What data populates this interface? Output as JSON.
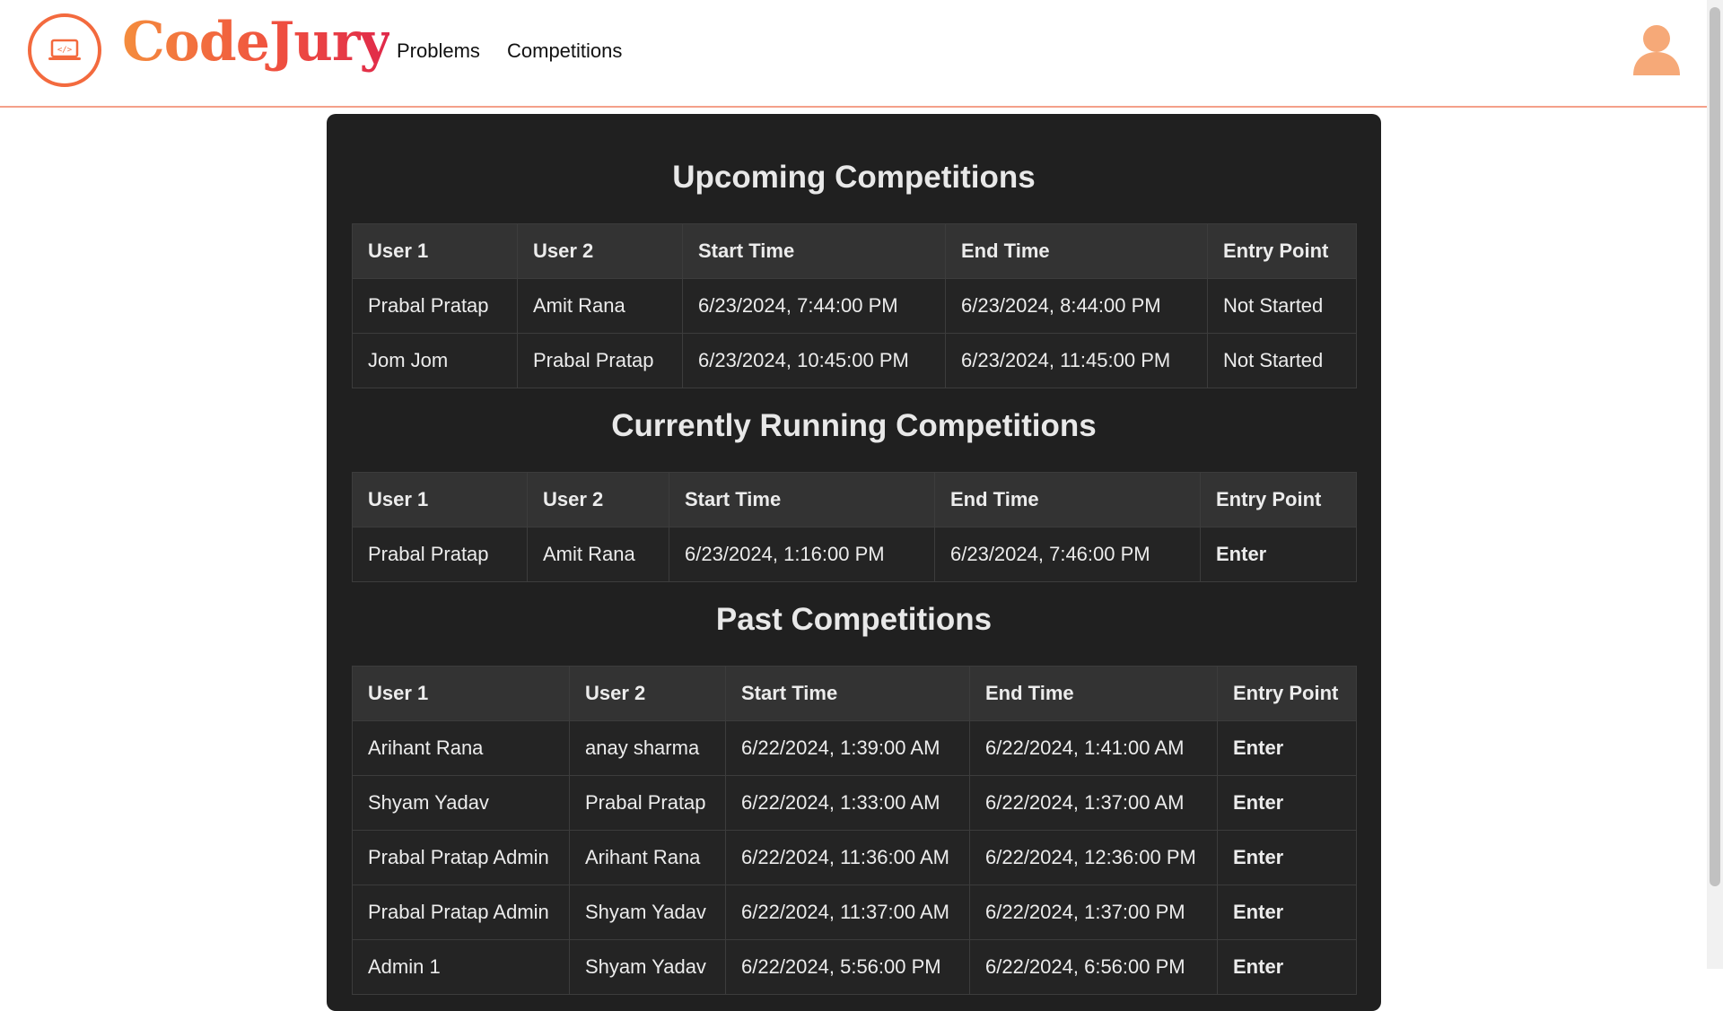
{
  "brand": "CodeJury",
  "nav": {
    "problems": "Problems",
    "competitions": "Competitions"
  },
  "colors": {
    "accent": "#f36a3e",
    "time": "#2ef01e",
    "link": "#1eb4f0",
    "panel": "#202020"
  },
  "upcoming": {
    "title": "Upcoming Competitions",
    "headers": [
      "User 1",
      "User 2",
      "Start Time",
      "End Time",
      "Entry Point"
    ],
    "rows": [
      {
        "user1": "Prabal Pratap",
        "user2": "Amit Rana",
        "start": "6/23/2024, 7:44:00 PM",
        "end": "6/23/2024, 8:44:00 PM",
        "entry": "Not Started"
      },
      {
        "user1": "Jom Jom",
        "user2": "Prabal Pratap",
        "start": "6/23/2024, 10:45:00 PM",
        "end": "6/23/2024, 11:45:00 PM",
        "entry": "Not Started"
      }
    ]
  },
  "running": {
    "title": "Currently Running Competitions",
    "headers": [
      "User 1",
      "User 2",
      "Start Time",
      "End Time",
      "Entry Point"
    ],
    "rows": [
      {
        "user1": "Prabal Pratap",
        "user2": "Amit Rana",
        "start": "6/23/2024, 1:16:00 PM",
        "end": "6/23/2024, 7:46:00 PM",
        "entry": "Enter"
      }
    ]
  },
  "past": {
    "title": "Past Competitions",
    "headers": [
      "User 1",
      "User 2",
      "Start Time",
      "End Time",
      "Entry Point"
    ],
    "rows": [
      {
        "user1": "Arihant Rana",
        "user2": "anay sharma",
        "start": "6/22/2024, 1:39:00 AM",
        "end": "6/22/2024, 1:41:00 AM",
        "entry": "Enter"
      },
      {
        "user1": "Shyam Yadav",
        "user2": "Prabal Pratap",
        "start": "6/22/2024, 1:33:00 AM",
        "end": "6/22/2024, 1:37:00 AM",
        "entry": "Enter"
      },
      {
        "user1": "Prabal Pratap Admin",
        "user2": "Arihant Rana",
        "start": "6/22/2024, 11:36:00 AM",
        "end": "6/22/2024, 12:36:00 PM",
        "entry": "Enter"
      },
      {
        "user1": "Prabal Pratap Admin",
        "user2": "Shyam Yadav",
        "start": "6/22/2024, 11:37:00 AM",
        "end": "6/22/2024, 1:37:00 PM",
        "entry": "Enter"
      },
      {
        "user1": "Admin 1",
        "user2": "Shyam Yadav",
        "start": "6/22/2024, 5:56:00 PM",
        "end": "6/22/2024, 6:56:00 PM",
        "entry": "Enter"
      }
    ]
  }
}
